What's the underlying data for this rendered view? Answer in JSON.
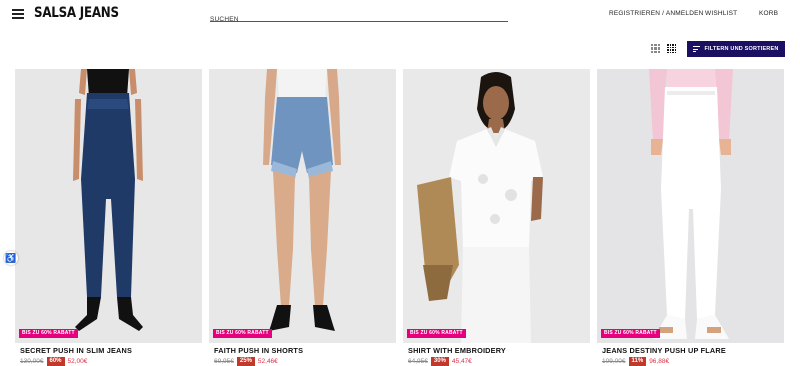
{
  "brand": {
    "logo": "SALSA JEANS"
  },
  "search": {
    "placeholder": "SUCHEN"
  },
  "nav": {
    "account": "REGISTRIEREN / ANMELDEN",
    "wishlist": "WISHLIST",
    "cart": "KORB"
  },
  "toolbar": {
    "filter_label": "FILTERN UND SORTIEREN"
  },
  "colors": {
    "filter_button": "#1b0f61",
    "badge": "#e6007e",
    "discount": "#c0392b",
    "sale_price": "#d9334a"
  },
  "products": [
    {
      "name": "SECRET PUSH IN SLIM JEANS",
      "badge": "BIS ZU 60% RABATT",
      "old_price": "130,00€",
      "discount": "60%",
      "price": "52,00€",
      "image": "dark-blue-slim-jeans"
    },
    {
      "name": "FAITH PUSH IN SHORTS",
      "badge": "BIS ZU 60% RABATT",
      "old_price": "69,95€",
      "discount": "25%",
      "price": "52,46€",
      "image": "denim-shorts"
    },
    {
      "name": "SHIRT WITH EMBROIDERY",
      "badge": "BIS ZU 60% RABATT",
      "old_price": "64,95€",
      "discount": "30%",
      "price": "45,47€",
      "image": "white-embroidered-shirt"
    },
    {
      "name": "JEANS DESTINY PUSH UP FLARE",
      "badge": "BIS ZU 60% RABATT",
      "old_price": "109,00€",
      "discount": "11%",
      "price": "96,88€",
      "image": "white-flare-jeans"
    }
  ]
}
